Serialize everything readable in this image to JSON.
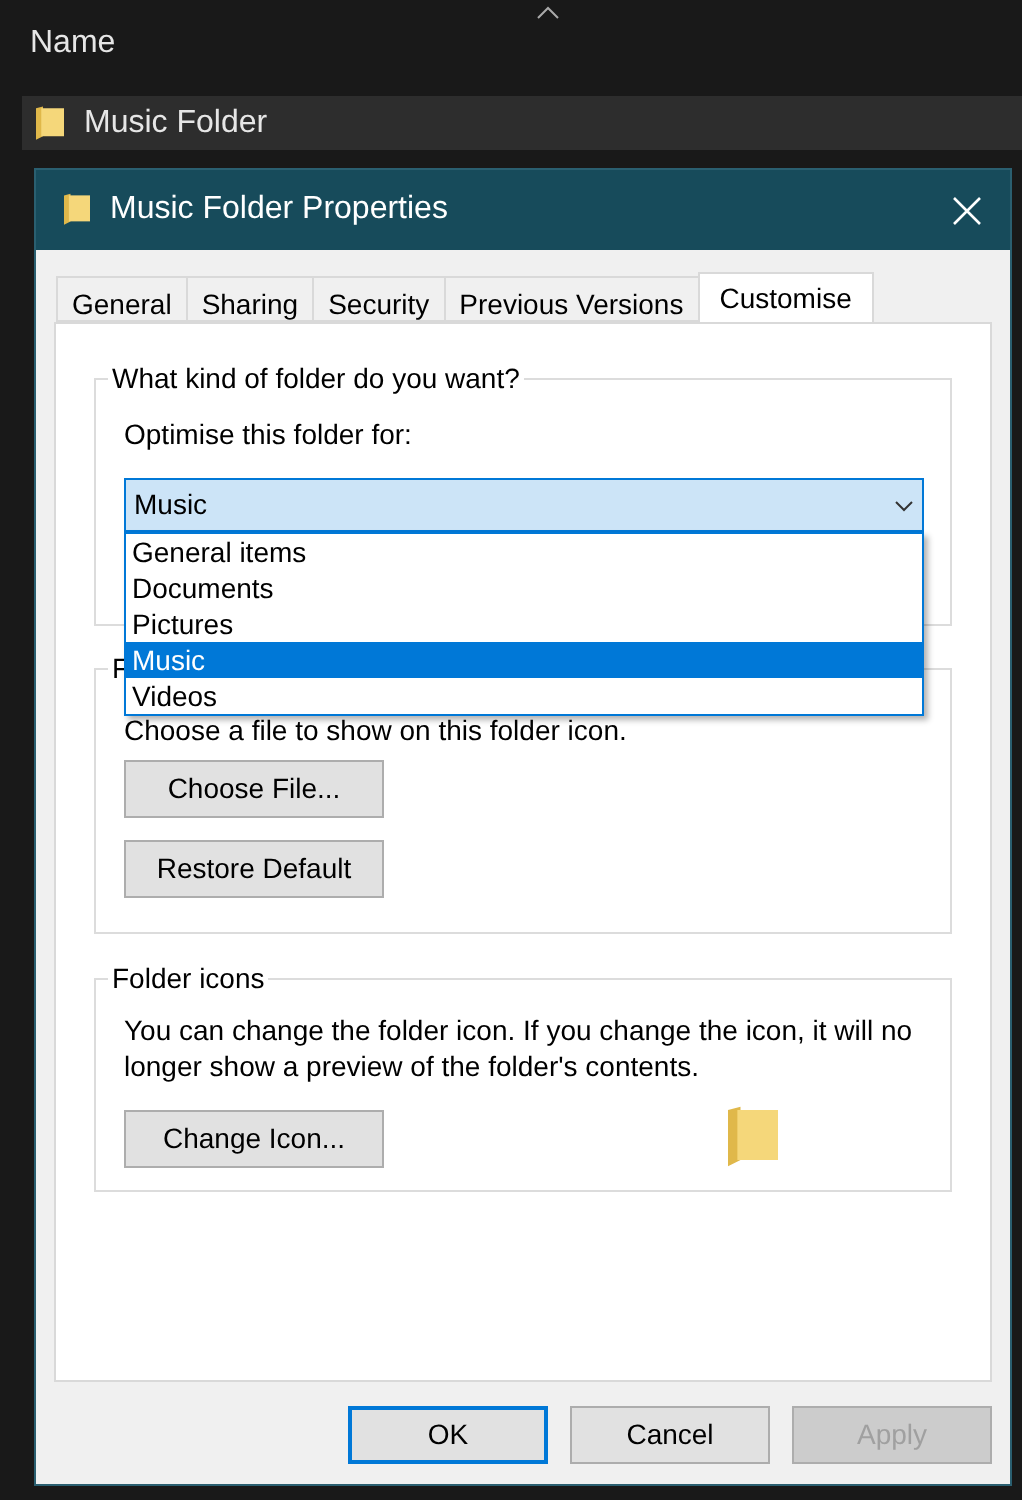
{
  "explorer": {
    "column_header": "Name",
    "items": [
      {
        "name": "Music Folder",
        "selected": true
      }
    ]
  },
  "dialog": {
    "title": "Music Folder Properties",
    "tabs": [
      {
        "label": "General",
        "selected": false
      },
      {
        "label": "Sharing",
        "selected": false
      },
      {
        "label": "Security",
        "selected": false
      },
      {
        "label": "Previous Versions",
        "selected": false
      },
      {
        "label": "Customise",
        "selected": true
      }
    ],
    "optimise_group": {
      "legend": "What kind of folder do you want?",
      "label": "Optimise this folder for:",
      "combo_value": "Music",
      "expanded": true,
      "options": [
        {
          "label": "General items",
          "selected": false
        },
        {
          "label": "Documents",
          "selected": false
        },
        {
          "label": "Pictures",
          "selected": false
        },
        {
          "label": "Music",
          "selected": true
        },
        {
          "label": "Videos",
          "selected": false
        }
      ]
    },
    "pictures_group": {
      "legend": "F",
      "description": "Choose a file to show on this folder icon.",
      "buttons": [
        "Choose File...",
        "Restore Default"
      ]
    },
    "icons_group": {
      "legend": "Folder icons",
      "description": "You can change the folder icon. If you change the icon, it will no longer show a preview of the folder's contents.",
      "button": "Change Icon..."
    },
    "buttons": [
      {
        "label": "OK",
        "default": true,
        "disabled": false
      },
      {
        "label": "Cancel",
        "default": false,
        "disabled": false
      },
      {
        "label": "Apply",
        "default": false,
        "disabled": true
      }
    ]
  }
}
